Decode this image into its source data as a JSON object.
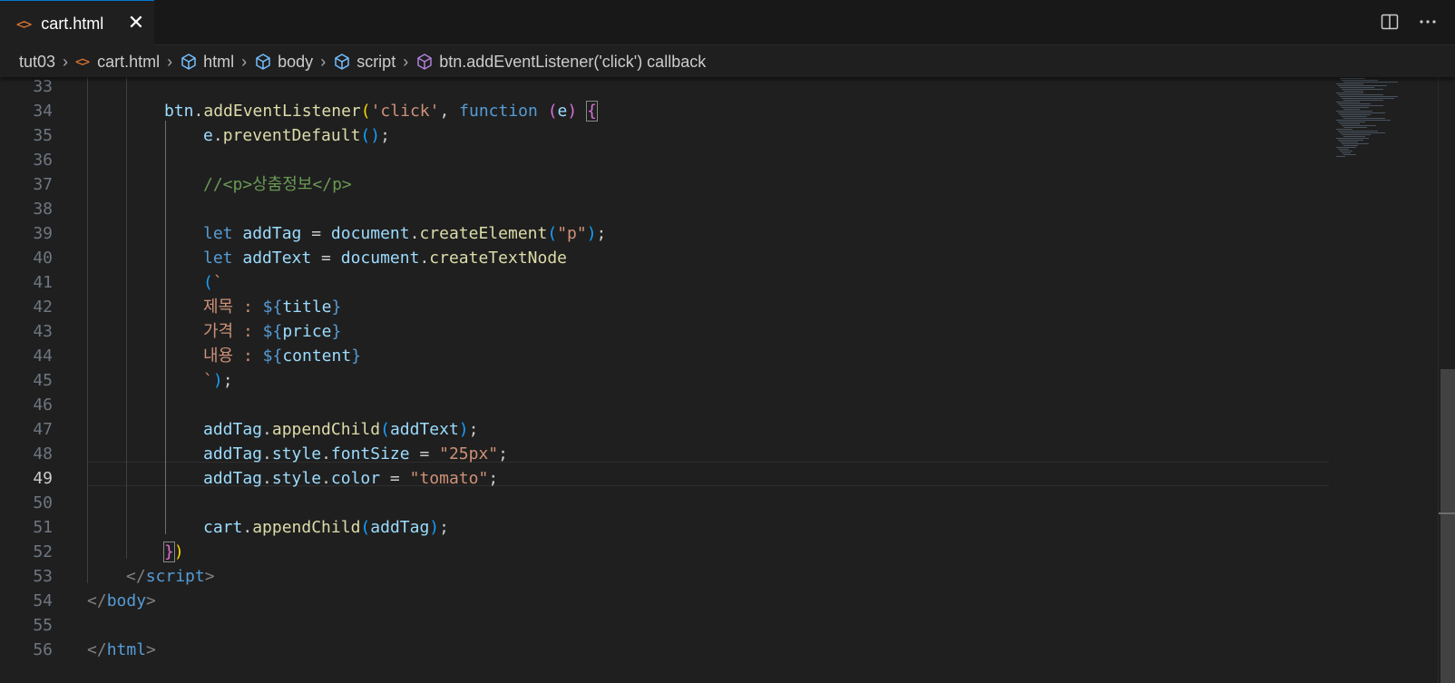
{
  "tab": {
    "label": "cart.html",
    "close_glyph": "✕",
    "icon": "html-file-icon"
  },
  "breadcrumb": [
    {
      "label": "tut03",
      "icon": "folder"
    },
    {
      "label": "cart.html",
      "icon": "html-file-icon"
    },
    {
      "label": "html",
      "icon": "symbol-field-icon"
    },
    {
      "label": "body",
      "icon": "symbol-field-icon"
    },
    {
      "label": "script",
      "icon": "symbol-field-icon"
    },
    {
      "label": "btn.addEventListener('click') callback",
      "icon": "symbol-method-icon"
    }
  ],
  "editor": {
    "active_line": 49,
    "lines": [
      {
        "n": "33",
        "tokens": []
      },
      {
        "n": "34",
        "tokens": [
          [
            "var",
            "btn"
          ],
          [
            "",
            "."
          ],
          [
            "fn",
            "addEventListener"
          ],
          [
            "b1",
            "("
          ],
          [
            "str",
            "'click'"
          ],
          [
            "",
            ", "
          ],
          [
            "kw",
            "function"
          ],
          [
            "",
            ""
          ],
          [
            "",
            " "
          ],
          [
            "b2",
            "("
          ],
          [
            "var",
            "e"
          ],
          [
            "b2",
            ")"
          ],
          [
            "",
            ""
          ],
          [
            "",
            " "
          ],
          [
            "b2",
            "{"
          ]
        ]
      },
      {
        "n": "35",
        "tokens": [
          [
            "var",
            "e"
          ],
          [
            "",
            "."
          ],
          [
            "fn",
            "preventDefault"
          ],
          [
            "b3",
            "()"
          ],
          [
            "",
            ";"
          ]
        ]
      },
      {
        "n": "36",
        "tokens": []
      },
      {
        "n": "37",
        "tokens": [
          [
            "cmt",
            "//<p>상춤정보</p>"
          ]
        ]
      },
      {
        "n": "38",
        "tokens": []
      },
      {
        "n": "39",
        "tokens": [
          [
            "kw",
            "let"
          ],
          [
            "",
            " "
          ],
          [
            "var",
            "addTag"
          ],
          [
            "",
            " = "
          ],
          [
            "var",
            "document"
          ],
          [
            "",
            "."
          ],
          [
            "fn",
            "createElement"
          ],
          [
            "b3",
            "("
          ],
          [
            "str",
            "\"p\""
          ],
          [
            "b3",
            ")"
          ],
          [
            "",
            ";"
          ]
        ]
      },
      {
        "n": "40",
        "tokens": [
          [
            "kw",
            "let"
          ],
          [
            "",
            " "
          ],
          [
            "var",
            "addText"
          ],
          [
            "",
            " = "
          ],
          [
            "var",
            "document"
          ],
          [
            "",
            "."
          ],
          [
            "fn",
            "createTextNode"
          ]
        ]
      },
      {
        "n": "41",
        "tokens": [
          [
            "b3",
            "("
          ],
          [
            "str",
            "`"
          ]
        ]
      },
      {
        "n": "42",
        "tokens": [
          [
            "str",
            "제목 : "
          ],
          [
            "tpl",
            "${"
          ],
          [
            "var",
            "title"
          ],
          [
            "tpl",
            "}"
          ]
        ]
      },
      {
        "n": "43",
        "tokens": [
          [
            "str",
            "가격 : "
          ],
          [
            "tpl",
            "${"
          ],
          [
            "var",
            "price"
          ],
          [
            "tpl",
            "}"
          ]
        ]
      },
      {
        "n": "44",
        "tokens": [
          [
            "str",
            "내용 : "
          ],
          [
            "tpl",
            "${"
          ],
          [
            "var",
            "content"
          ],
          [
            "tpl",
            "}"
          ]
        ]
      },
      {
        "n": "45",
        "tokens": [
          [
            "str",
            "`"
          ],
          [
            "b3",
            ")"
          ],
          [
            "",
            ";"
          ]
        ]
      },
      {
        "n": "46",
        "tokens": []
      },
      {
        "n": "47",
        "tokens": [
          [
            "var",
            "addTag"
          ],
          [
            "",
            "."
          ],
          [
            "fn",
            "appendChild"
          ],
          [
            "b3",
            "("
          ],
          [
            "var",
            "addText"
          ],
          [
            "b3",
            ")"
          ],
          [
            "",
            ";"
          ]
        ]
      },
      {
        "n": "48",
        "tokens": [
          [
            "var",
            "addTag"
          ],
          [
            "",
            "."
          ],
          [
            "var",
            "style"
          ],
          [
            "",
            "."
          ],
          [
            "var",
            "fontSize"
          ],
          [
            "",
            " = "
          ],
          [
            "str",
            "\"25px\""
          ],
          [
            "",
            ";"
          ]
        ]
      },
      {
        "n": "49",
        "tokens": [
          [
            "var",
            "addTag"
          ],
          [
            "",
            "."
          ],
          [
            "var",
            "style"
          ],
          [
            "",
            "."
          ],
          [
            "var",
            "color"
          ],
          [
            "",
            " = "
          ],
          [
            "str",
            "\"tomato\""
          ],
          [
            "",
            ";"
          ]
        ]
      },
      {
        "n": "50",
        "tokens": []
      },
      {
        "n": "51",
        "tokens": [
          [
            "var",
            "cart"
          ],
          [
            "",
            "."
          ],
          [
            "fn",
            "appendChild"
          ],
          [
            "b3",
            "("
          ],
          [
            "var",
            "addTag"
          ],
          [
            "b3",
            ")"
          ],
          [
            "",
            ";"
          ]
        ]
      },
      {
        "n": "52",
        "tokens": [
          [
            "b2",
            "}"
          ],
          [
            "b1",
            ")"
          ]
        ]
      },
      {
        "n": "53",
        "tokens": [
          [
            "punc",
            "</"
          ],
          [
            "tag",
            "script"
          ],
          [
            "punc",
            ">"
          ]
        ]
      },
      {
        "n": "54",
        "tokens": [
          [
            "punc",
            "</"
          ],
          [
            "tag",
            "body"
          ],
          [
            "punc",
            ">"
          ]
        ]
      },
      {
        "n": "55",
        "tokens": []
      },
      {
        "n": "56",
        "tokens": [
          [
            "punc",
            "</"
          ],
          [
            "tag",
            "html"
          ],
          [
            "punc",
            ">"
          ]
        ]
      }
    ]
  }
}
